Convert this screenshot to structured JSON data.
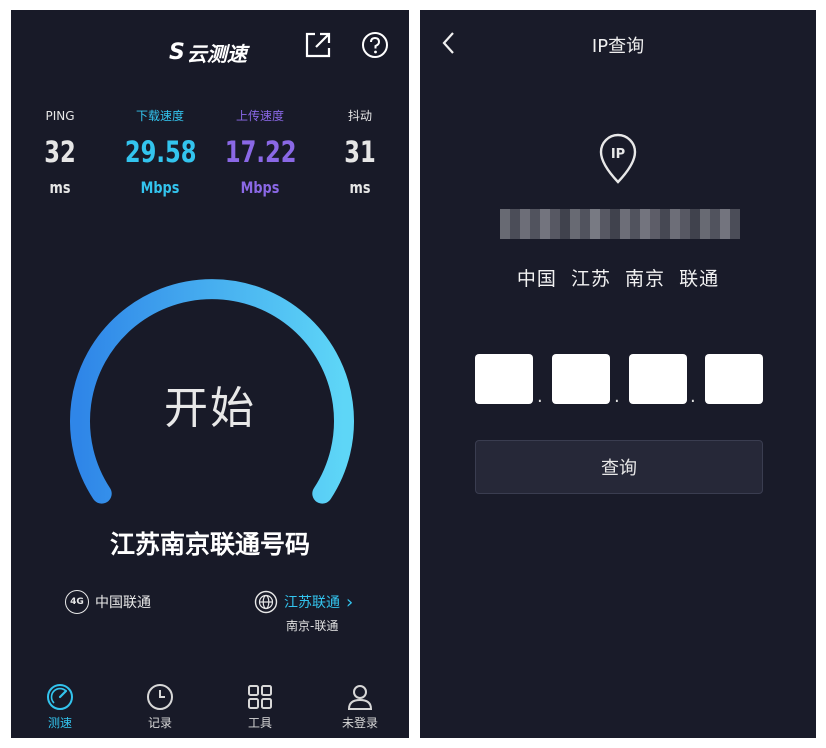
{
  "left": {
    "app_logo_text": "云测速",
    "stats": {
      "ping": {
        "label": "PING",
        "value": "32",
        "unit": "ms"
      },
      "download": {
        "label": "下载速度",
        "value": "29.58",
        "unit": "Mbps"
      },
      "upload": {
        "label": "上传速度",
        "value": "17.22",
        "unit": "Mbps"
      },
      "jitter": {
        "label": "抖动",
        "value": "31",
        "unit": "ms"
      }
    },
    "start_label": "开始",
    "region_title": "江苏南京联通号码",
    "network": {
      "badge": "4G",
      "carrier": "中国联通"
    },
    "server": {
      "name": "江苏联通",
      "chevron": "›",
      "sub": "南京-联通"
    },
    "nav": [
      {
        "label": "测速",
        "icon": "speedometer-icon"
      },
      {
        "label": "记录",
        "icon": "clock-icon"
      },
      {
        "label": "工具",
        "icon": "grid-icon"
      },
      {
        "label": "未登录",
        "icon": "user-icon"
      }
    ],
    "colors": {
      "download": "#33c4ee",
      "upload": "#8a68e6",
      "background": "#181a28"
    }
  },
  "right": {
    "title": "IP查询",
    "pin_text": "IP",
    "location": "中国  江苏  南京  联通",
    "octet_separators": [
      ".",
      ".",
      "."
    ],
    "query_button": "查询"
  }
}
